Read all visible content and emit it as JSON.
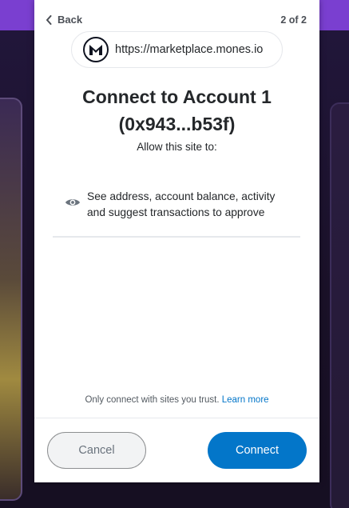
{
  "header": {
    "back_label": "Back",
    "step": "2 of 2"
  },
  "site": {
    "url": "https://marketplace.mones.io",
    "logo_icon": "mones-logo-icon"
  },
  "title": {
    "line1": "Connect to Account 1",
    "line2": "(0x943...b53f)"
  },
  "subtitle": "Allow this site to:",
  "permissions": [
    {
      "icon": "eye-icon",
      "line1": "See address, account balance, activity",
      "line2": "and suggest transactions to approve"
    }
  ],
  "trust": {
    "text": "Only connect with sites you trust.",
    "link": "Learn more"
  },
  "buttons": {
    "cancel": "Cancel",
    "connect": "Connect"
  },
  "colors": {
    "primary": "#0376c9",
    "text": "#24272a",
    "background_accent": "#7a3fd0"
  }
}
